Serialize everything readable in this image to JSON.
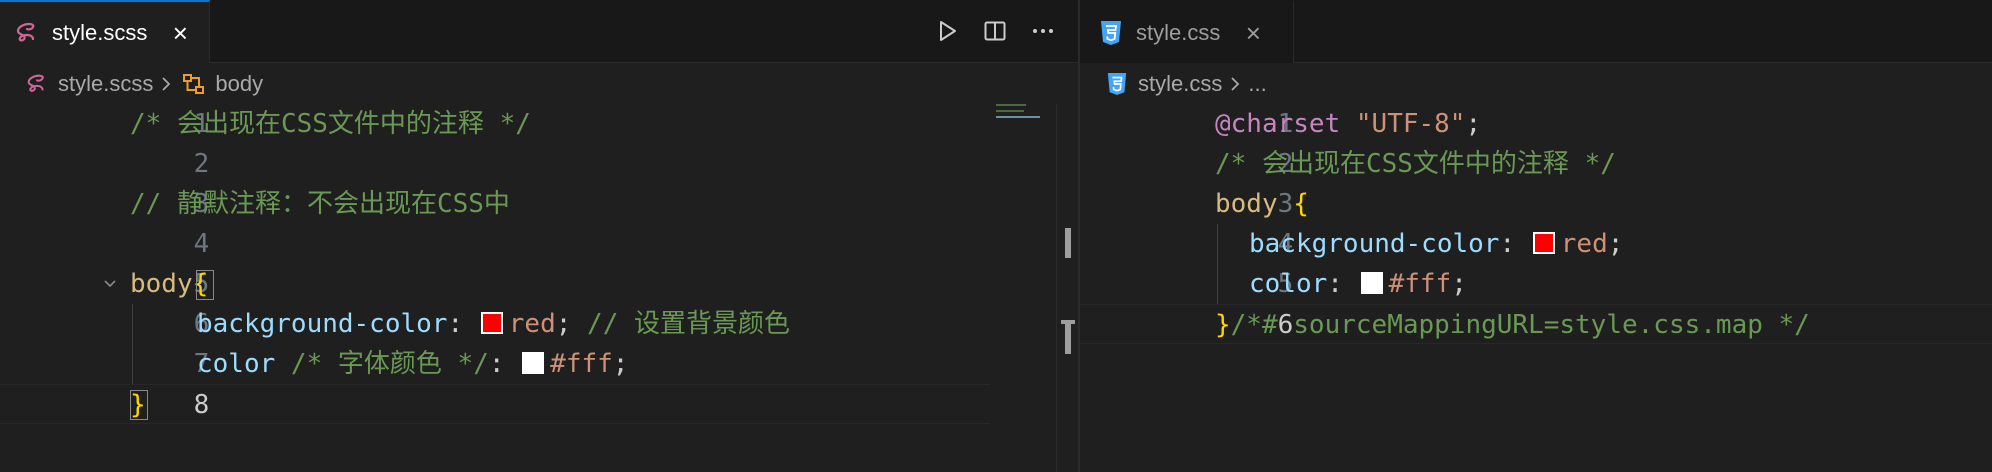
{
  "colors": {
    "accent": "#0078d4",
    "sass_icon": "#cd6799",
    "css_icon": "#42a5f5",
    "symbol_icon": "#ee9d28",
    "swatch_red": "#ff0000",
    "swatch_white": "#ffffff"
  },
  "left": {
    "tab": {
      "title": "style.scss",
      "icon": "sass-icon",
      "close": "×"
    },
    "actions": [
      "run-icon",
      "split-editor-icon",
      "more-actions-icon"
    ],
    "breadcrumb": {
      "file": "style.scss",
      "file_icon": "sass-icon",
      "symbol": "body",
      "symbol_icon": "symbol-structure-icon"
    },
    "lines": [
      {
        "num": "1",
        "comment": "/* 会出现在CSS文件中的注释 */"
      },
      {
        "num": "2"
      },
      {
        "num": "3",
        "comment": "// 静默注释：不会出现在CSS中"
      },
      {
        "num": "4"
      },
      {
        "num": "5",
        "selector": "body",
        "brace": "{"
      },
      {
        "num": "6",
        "prop": "background-color",
        "colon": ":",
        "value": "red",
        "semi": ";",
        "comment": " // 设置背景颜色"
      },
      {
        "num": "7",
        "prop": "color",
        "comment": " /* 字体颜色 */",
        "colon": ":",
        "value": "#fff",
        "semi": ";"
      },
      {
        "num": "8",
        "brace": "}"
      }
    ]
  },
  "right": {
    "tab": {
      "title": "style.css",
      "icon": "css3-icon",
      "close": "×"
    },
    "breadcrumb": {
      "file": "style.css",
      "file_icon": "css3-icon",
      "ellipsis": "..."
    },
    "lines": [
      {
        "num": "1",
        "at": "@charset",
        "string": " \"UTF-8\"",
        "semi": ";"
      },
      {
        "num": "2",
        "comment": "/* 会出现在CSS文件中的注释 */"
      },
      {
        "num": "3",
        "selector": "body ",
        "brace": "{"
      },
      {
        "num": "4",
        "prop": "background-color",
        "colon": ": ",
        "value": "red",
        "semi": ";"
      },
      {
        "num": "5",
        "prop": "color",
        "colon": ": ",
        "value": "#fff",
        "semi": ";"
      },
      {
        "num": "6",
        "brace": "}",
        "comment": "/*# sourceMappingURL=style.css.map */"
      }
    ]
  }
}
